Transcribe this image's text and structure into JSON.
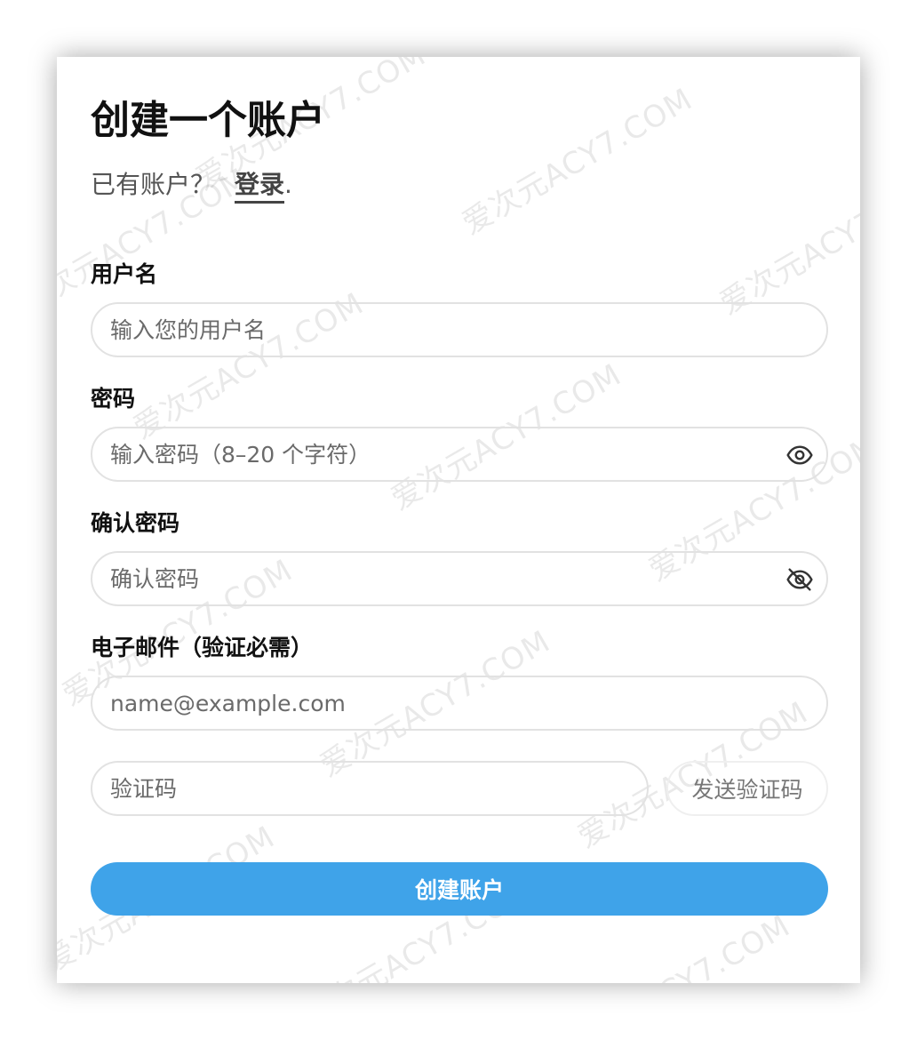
{
  "watermark_text": "爱次元ACY7.COM",
  "form": {
    "title": "创建一个账户",
    "have_account_text": "已有账户？",
    "login_link": "登录",
    "login_suffix": ".",
    "username": {
      "label": "用户名",
      "placeholder": "输入您的用户名",
      "value": ""
    },
    "password": {
      "label": "密码",
      "placeholder": "输入密码（8–20 个字符）",
      "value": "",
      "toggle_icon": "eye-icon"
    },
    "confirm_password": {
      "label": "确认密码",
      "placeholder": "确认密码",
      "value": "",
      "toggle_icon": "eye-off-icon"
    },
    "email": {
      "label": "电子邮件（验证必需）",
      "placeholder": "name@example.com",
      "value": ""
    },
    "verification_code": {
      "placeholder": "验证码",
      "value": "",
      "send_button": "发送验证码"
    },
    "submit_button": "创建账户"
  },
  "colors": {
    "primary_button": "#3fa3e9",
    "field_border": "#e2e2e2"
  }
}
